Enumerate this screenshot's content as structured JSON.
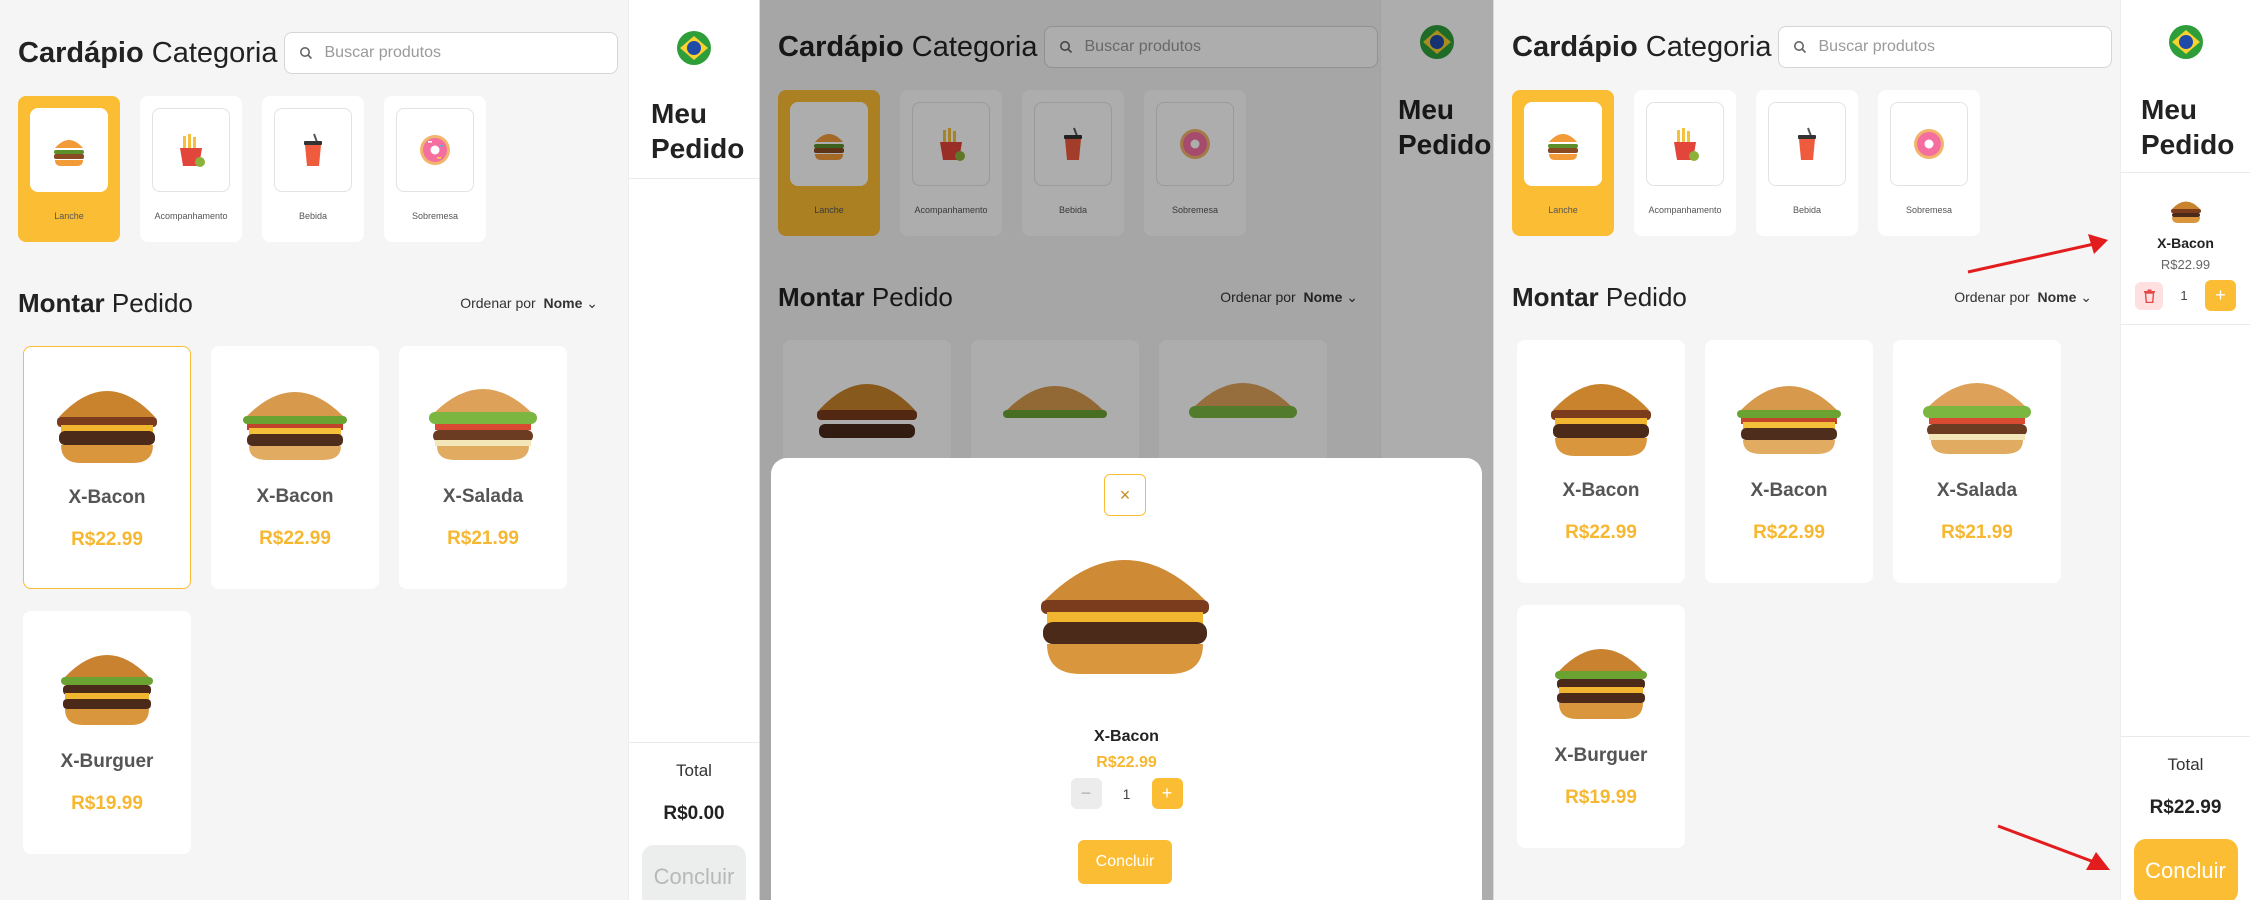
{
  "header": {
    "title_bold": "Cardápio",
    "title_rest": "Categoria",
    "search_placeholder": "Buscar produtos"
  },
  "categories": [
    {
      "label": "Lanche",
      "icon": "burger-icon",
      "selected": true
    },
    {
      "label": "Acompanhamento",
      "icon": "fries-icon",
      "selected": false
    },
    {
      "label": "Bebida",
      "icon": "drink-icon",
      "selected": false
    },
    {
      "label": "Sobremesa",
      "icon": "donut-icon",
      "selected": false
    }
  ],
  "section": {
    "title_bold": "Montar",
    "title_rest": "Pedido",
    "sort_label": "Ordenar por",
    "sort_value": "Nome"
  },
  "products": [
    {
      "name": "X-Bacon",
      "price": "R$22.99"
    },
    {
      "name": "X-Bacon",
      "price": "R$22.99"
    },
    {
      "name": "X-Salada",
      "price": "R$21.99"
    },
    {
      "name": "X-Burguer",
      "price": "R$19.99"
    }
  ],
  "sidebar": {
    "title": "Meu Pedido",
    "total_label": "Total",
    "checkout_label": "Concluir"
  },
  "states": {
    "empty_total": "R$0.00",
    "filled_total": "R$22.99"
  },
  "modal": {
    "close": "×",
    "name": "X-Bacon",
    "price": "R$22.99",
    "minus": "−",
    "quantity": "1",
    "plus": "+",
    "confirm": "Concluir"
  },
  "cart_item": {
    "name": "X-Bacon",
    "price": "R$22.99",
    "quantity": "1",
    "plus": "+"
  },
  "colors": {
    "accent": "#fbbd33",
    "price": "#f6b731",
    "annotation": "#e31d1d"
  }
}
